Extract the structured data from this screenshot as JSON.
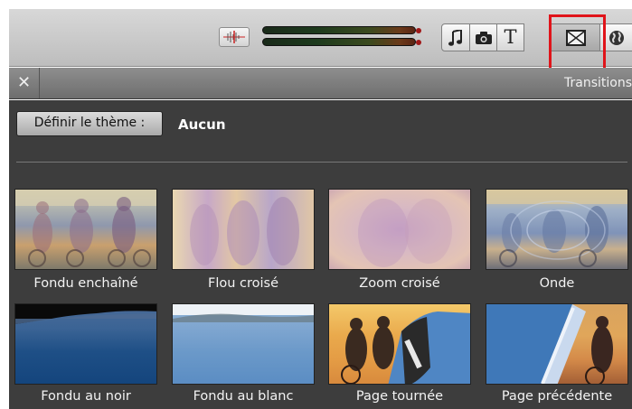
{
  "toolbar": {
    "buttons": [
      {
        "name": "waveform-icon"
      },
      {
        "name": "music-icon"
      },
      {
        "name": "camera-icon"
      },
      {
        "name": "text-icon",
        "glyph": "T"
      },
      {
        "name": "transitions-icon"
      },
      {
        "name": "globe-icon"
      }
    ],
    "highlight_color": "#e0141a"
  },
  "panel": {
    "close_glyph": "✕",
    "title": "Transitions"
  },
  "theme": {
    "button_label": "Définir le thème :",
    "value": "Aucun"
  },
  "transitions": [
    {
      "label": "Fondu enchaîné"
    },
    {
      "label": "Flou croisé"
    },
    {
      "label": "Zoom croisé"
    },
    {
      "label": "Onde"
    },
    {
      "label": "Fondu au noir"
    },
    {
      "label": "Fondu au blanc"
    },
    {
      "label": "Page tournée"
    },
    {
      "label": "Page précédente"
    }
  ]
}
